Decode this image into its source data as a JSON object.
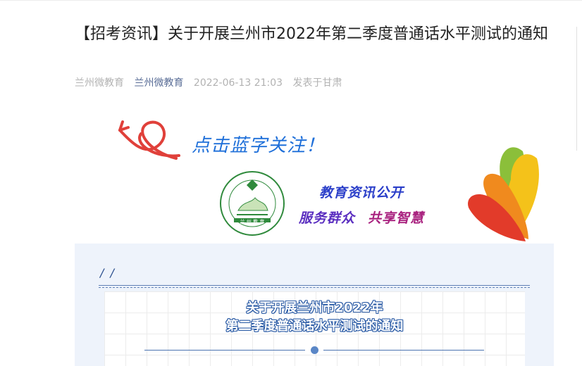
{
  "article": {
    "title": "【招考资讯】关于开展兰州市2022年第二季度普通话水平测试的通知",
    "author": "兰州微教育",
    "account": "兰州微教育",
    "datetime": "2022-06-13 21:03",
    "location": "发表于甘肃"
  },
  "banner": {
    "follow_text": "点击蓝字关注！",
    "slogan_line1": "教育资讯公开",
    "slogan_part_a": "服务群众",
    "slogan_part_b": "共享智慧",
    "logo_text": "LANZHOU EDUCATION",
    "logo_chars": "兰 州 教 育",
    "colors": {
      "arrow": "#e0403a",
      "follow": "#1e6fd9",
      "leaf_red": "#e23b2a",
      "leaf_orange": "#f08a1e",
      "leaf_yellow": "#f4c21a",
      "leaf_green": "#8bbf3a",
      "logo_green": "#2f8a3c"
    }
  },
  "card": {
    "slashes": "/ /",
    "heading_line1": "关于开展兰州市2022年",
    "heading_line2": "第二季度普通话水平测试的通知"
  }
}
